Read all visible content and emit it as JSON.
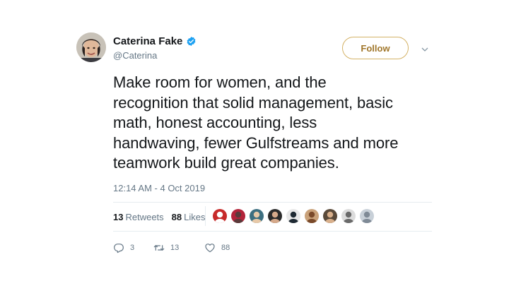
{
  "author": {
    "display_name": "Caterina Fake",
    "handle": "@Caterina",
    "verified": true,
    "avatar_icon": "profile-photo"
  },
  "follow_button": {
    "label": "Follow",
    "color": "#a0762a",
    "border": "#d4b266"
  },
  "tweet": {
    "lines": [
      "Make room for women, and the",
      "recognition that solid management, basic",
      "math, honest accounting, less",
      "handwaving, fewer Gulfstreams and more",
      "teamwork build great companies."
    ],
    "timestamp": "12:14 AM - 4 Oct 2019"
  },
  "stats": {
    "retweets_count": "13",
    "retweets_label": "Retweets",
    "likes_count": "88",
    "likes_label": "Likes"
  },
  "liker_avatars": [
    {
      "name": "liker-1",
      "bg": "#c72a2a",
      "fg": "#ffffff"
    },
    {
      "name": "liker-2",
      "bg": "#b3243a",
      "fg": "#5a3a3a"
    },
    {
      "name": "liker-3",
      "bg": "#3d6f80",
      "fg": "#e8c9a8"
    },
    {
      "name": "liker-4",
      "bg": "#2b2b2b",
      "fg": "#d6a98a"
    },
    {
      "name": "liker-5",
      "bg": "#e8e8e8",
      "fg": "#1f2a33"
    },
    {
      "name": "liker-6",
      "bg": "#c9a27a",
      "fg": "#7a4a2a"
    },
    {
      "name": "liker-7",
      "bg": "#5a4a3a",
      "fg": "#d9b08c"
    },
    {
      "name": "liker-8",
      "bg": "#dcdcdc",
      "fg": "#6a6a6a"
    },
    {
      "name": "liker-9",
      "bg": "#c8d0d8",
      "fg": "#7f8a96"
    }
  ],
  "actions": {
    "reply_icon": "reply-icon",
    "reply_count": "3",
    "retweet_icon": "retweet-icon",
    "retweet_count": "13",
    "like_icon": "heart-icon",
    "like_count": "88"
  },
  "colors": {
    "text": "#14171a",
    "muted": "#657786",
    "verified": "#1da1f2",
    "divider": "#e6ecf0"
  }
}
